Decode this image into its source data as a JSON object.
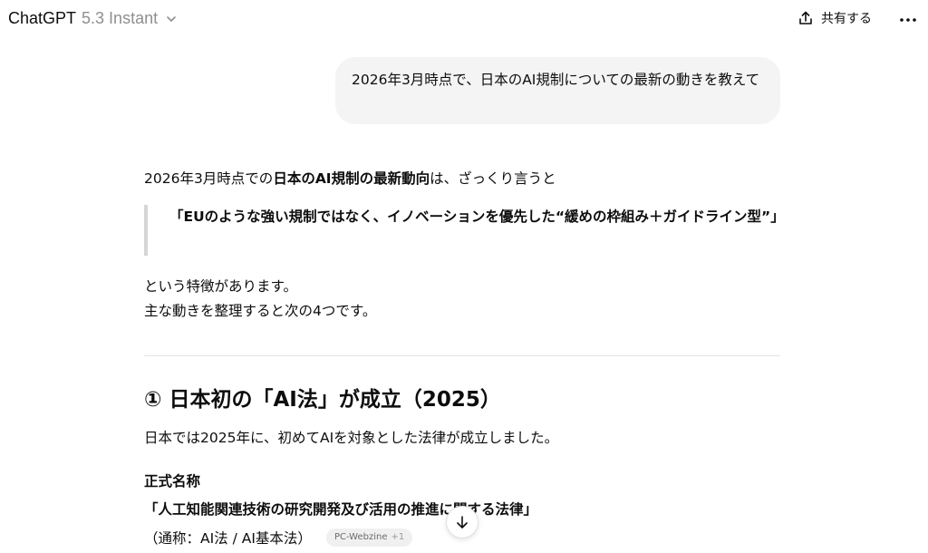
{
  "header": {
    "app_name": "ChatGPT",
    "model_version": "5.3 Instant",
    "share_label": "共有する",
    "icons": {
      "model_dropdown": "chevron-down-icon",
      "share": "share-upload-icon",
      "more": "more-horizontal-icon"
    }
  },
  "user_message": {
    "text": "2026年3月時点で、日本のAI規制についての最新の動きを教えて"
  },
  "assistant": {
    "intro_prefix": "2026年3月時点での",
    "intro_bold": "日本のAI規制の最新動向",
    "intro_suffix": "は、ざっくり言うと",
    "quote": "「EUのような強い規制ではなく、イノベーションを優先した“緩めの枠組み＋ガイドライン型”」",
    "after_line1": "という特徴があります。",
    "after_line2": "主な動きを整理すると次の4つです。",
    "section_heading": "① 日本初の「AI法」が成立（2025）",
    "section_paragraph": "日本では2025年に、初めてAIを対象とした法律が成立しました。",
    "official_name_label": "正式名称",
    "official_name": "「人工知能関連技術の研究開発及び活用の推進に関する法律」",
    "alias": "（通称：AI法 / AI基本法）",
    "source_chip": {
      "name": "PC-Webzine",
      "count": "+1"
    }
  },
  "controls": {
    "scroll_down_icon": "arrow-down-icon"
  }
}
